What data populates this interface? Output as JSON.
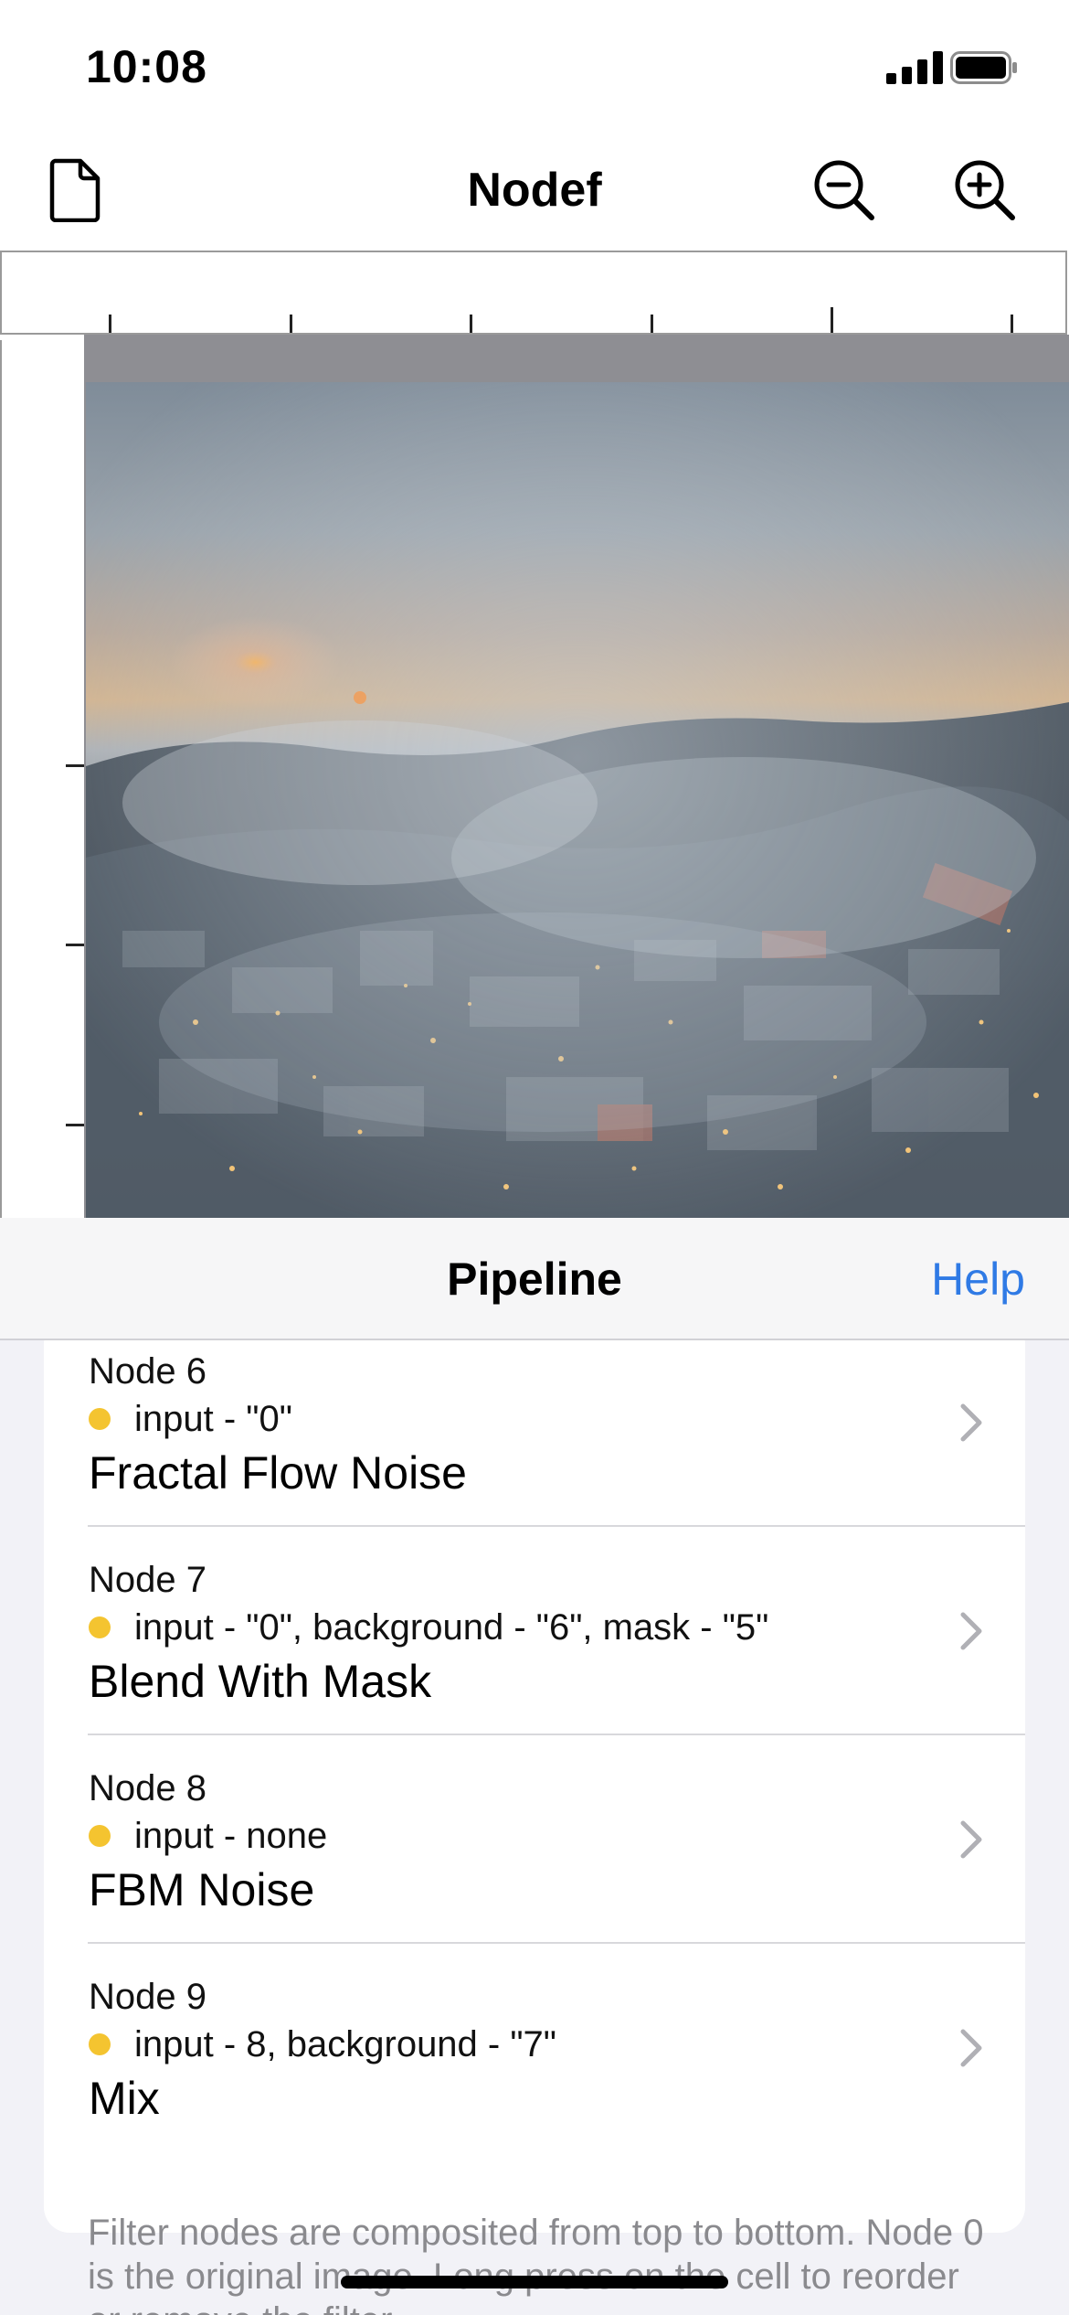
{
  "status_bar": {
    "time": "10:08"
  },
  "nav": {
    "title": "Nodef"
  },
  "sheet": {
    "title": "Pipeline",
    "help_label": "Help"
  },
  "nodes": [
    {
      "number": "Node 6",
      "inputs": "input - \"0\"",
      "filter": "Fractal Flow Noise"
    },
    {
      "number": "Node 7",
      "inputs": "input - \"0\", background - \"6\", mask - \"5\"",
      "filter": "Blend With Mask"
    },
    {
      "number": "Node 8",
      "inputs": "input - none",
      "filter": "FBM Noise"
    },
    {
      "number": "Node 9",
      "inputs": "input - 8, background - \"7\"",
      "filter": "Mix"
    }
  ],
  "footer": "Filter nodes are composited from top to bottom. Node 0 is the original image. Long press on the cell to reorder or remove the filter.",
  "colors": {
    "accent": "#2f7ae5",
    "status_dot": "#f4c430",
    "canvas_gray": "#8e8e93"
  },
  "icons": [
    "document-icon",
    "zoom-out-icon",
    "zoom-in-icon",
    "chevron-right-icon"
  ]
}
